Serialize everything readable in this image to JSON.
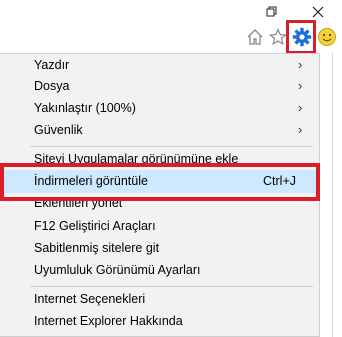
{
  "titlebar": {
    "restore_icon": "restore-icon",
    "close_icon": "close-icon"
  },
  "toolbar": {
    "home_icon": "home-icon",
    "favorites_icon": "star-icon",
    "tools_icon": "gear-icon",
    "feedback_icon": "smiley-icon",
    "accent": "#1e6fd9"
  },
  "menu": {
    "group1": [
      {
        "label": "Yazdır",
        "submenu": true
      },
      {
        "label": "Dosya",
        "submenu": true
      },
      {
        "label": "Yakınlaştır (100%)",
        "submenu": true
      },
      {
        "label": "Güvenlik",
        "submenu": true
      }
    ],
    "group2": [
      {
        "label": "Siteyi Uygulamalar görünümüne ekle"
      },
      {
        "label": "İndirmeleri görüntüle",
        "shortcut": "Ctrl+J",
        "highlighted": true
      },
      {
        "label": "Eklentileri yönet"
      },
      {
        "label": "F12 Geliştirici Araçları"
      },
      {
        "label": "Sabitlenmiş sitelere git"
      },
      {
        "label": "Uyumluluk Görünümü Ayarları"
      }
    ],
    "group3": [
      {
        "label": "Internet Seçenekleri"
      },
      {
        "label": "Internet Explorer Hakkında"
      }
    ],
    "submenu_arrow": "›"
  },
  "colors": {
    "highlight_border": "#d5202a",
    "hover_fill": "#cde8ff",
    "menu_bg": "#f2f2f2"
  }
}
